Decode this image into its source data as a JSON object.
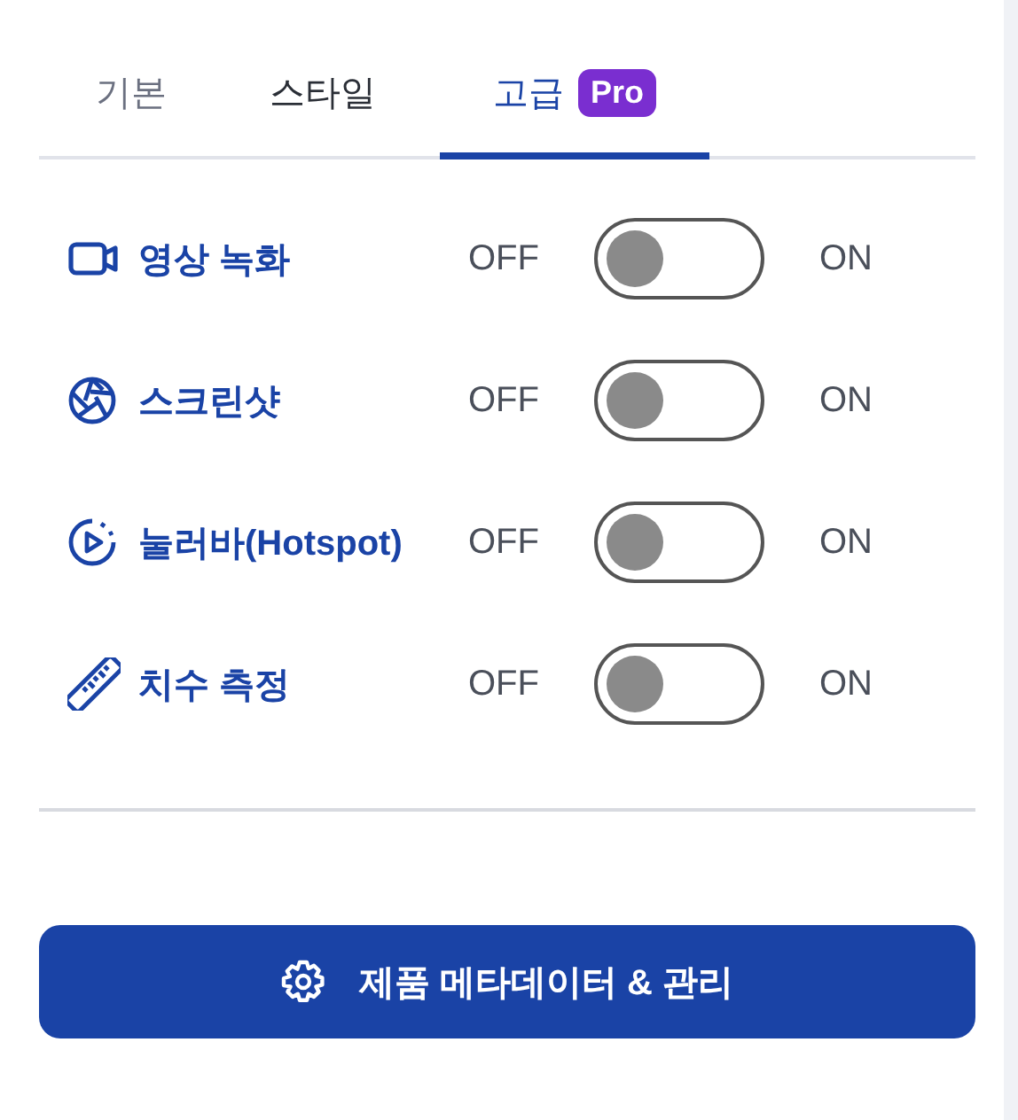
{
  "tabs": [
    {
      "label": "기본",
      "selected": false
    },
    {
      "label": "스타일",
      "selected": false
    },
    {
      "label": "고급",
      "selected": true,
      "badge": "Pro"
    }
  ],
  "settings": [
    {
      "label": "영상 녹화",
      "off_label": "OFF",
      "on_label": "ON",
      "on": false
    },
    {
      "label": "스크린샷",
      "off_label": "OFF",
      "on_label": "ON",
      "on": false
    },
    {
      "label": "눌러바(Hotspot)",
      "off_label": "OFF",
      "on_label": "ON",
      "on": false
    },
    {
      "label": "치수 측정",
      "off_label": "OFF",
      "on_label": "ON",
      "on": false
    }
  ],
  "action_button": {
    "label": "제품 메타데이터 & 관리"
  }
}
